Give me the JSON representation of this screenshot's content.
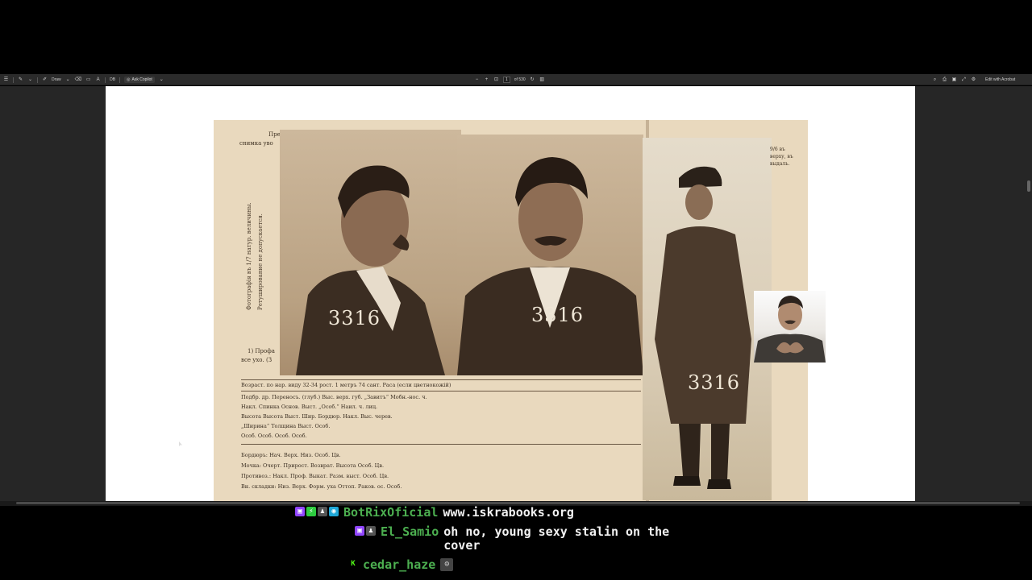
{
  "toolbar": {
    "draw_label": "Draw",
    "zoom_value": "DB",
    "copilot_label": "Ask Copilot",
    "page_current": "1",
    "page_total": "of 530",
    "edit_label": "Edit with Acrobat"
  },
  "document": {
    "vertical_text_1": "Фотографія въ 1/7 натур. величины.",
    "vertical_text_2": "Ретуширование не допускается.",
    "header_text_1": "Пре",
    "header_text_2": "снимка уво",
    "side_note": "9/6 въ верху, въ выдаль.",
    "photo_number": "3316",
    "caption_line_1": "1) Профа",
    "caption_line_2": "все ухо. (З",
    "form_rows": [
      "Возраст. по нар. виду 32-34 рост. 1 метръ 74 сант.   Раса (если цветнокожій)",
      "Подбр. др.     Переносъ. (глуб.)      Выс. верх. губ.   „Завитъ“      Мобн.-нос. ч.",
      "Накл.          Спинка   Основ.        Выст.             „Особ.“        Наил. ч. лиц.",
      "Высота         Высота   Выст.  Шир.   Бордюр.           Накл.          Выс. черев.",
      "„Ширина“                              Толщина           Выст.          Особ.",
      "Особ.          Особ.                  Особ.             Особ.",
      "Бордюръ: Нач.    Верх.    Низ.     Особ.               Цв.",
      "Мочка: Очерт.    Прирост. Возврат. Высота    Особ.     Цв.",
      "Противоз.: Накл. Проф.    Выкат.   Разм. выст. Особ.   Цв.",
      "Вн. складки: Низ. Верх.   Форм. уха  Оттоп.   Раков.  ос.   Особ."
    ]
  },
  "chat": {
    "messages": [
      {
        "user": "BotRixOficial",
        "user_color": "#4caf50",
        "text": "www.iskrabooks.org",
        "badges": [
          "twitch-icon",
          "bot-icon",
          "broadcaster-icon",
          "partner-icon"
        ]
      },
      {
        "user": "El_Samio",
        "user_color": "#4caf50",
        "text": "oh no, young sexy stalin on the cover",
        "badges": [
          "twitch-icon",
          "user-icon"
        ]
      },
      {
        "user": "cedar_haze",
        "user_color": "#4caf50",
        "text": "",
        "badges": [
          "kick-icon"
        ],
        "emote": "emote-icon"
      }
    ]
  },
  "colors": {
    "background": "#000000",
    "viewer_bg": "#262626",
    "toolbar_bg": "#2b2b2b",
    "paper": "#e9d9be",
    "username": "#4caf50"
  }
}
